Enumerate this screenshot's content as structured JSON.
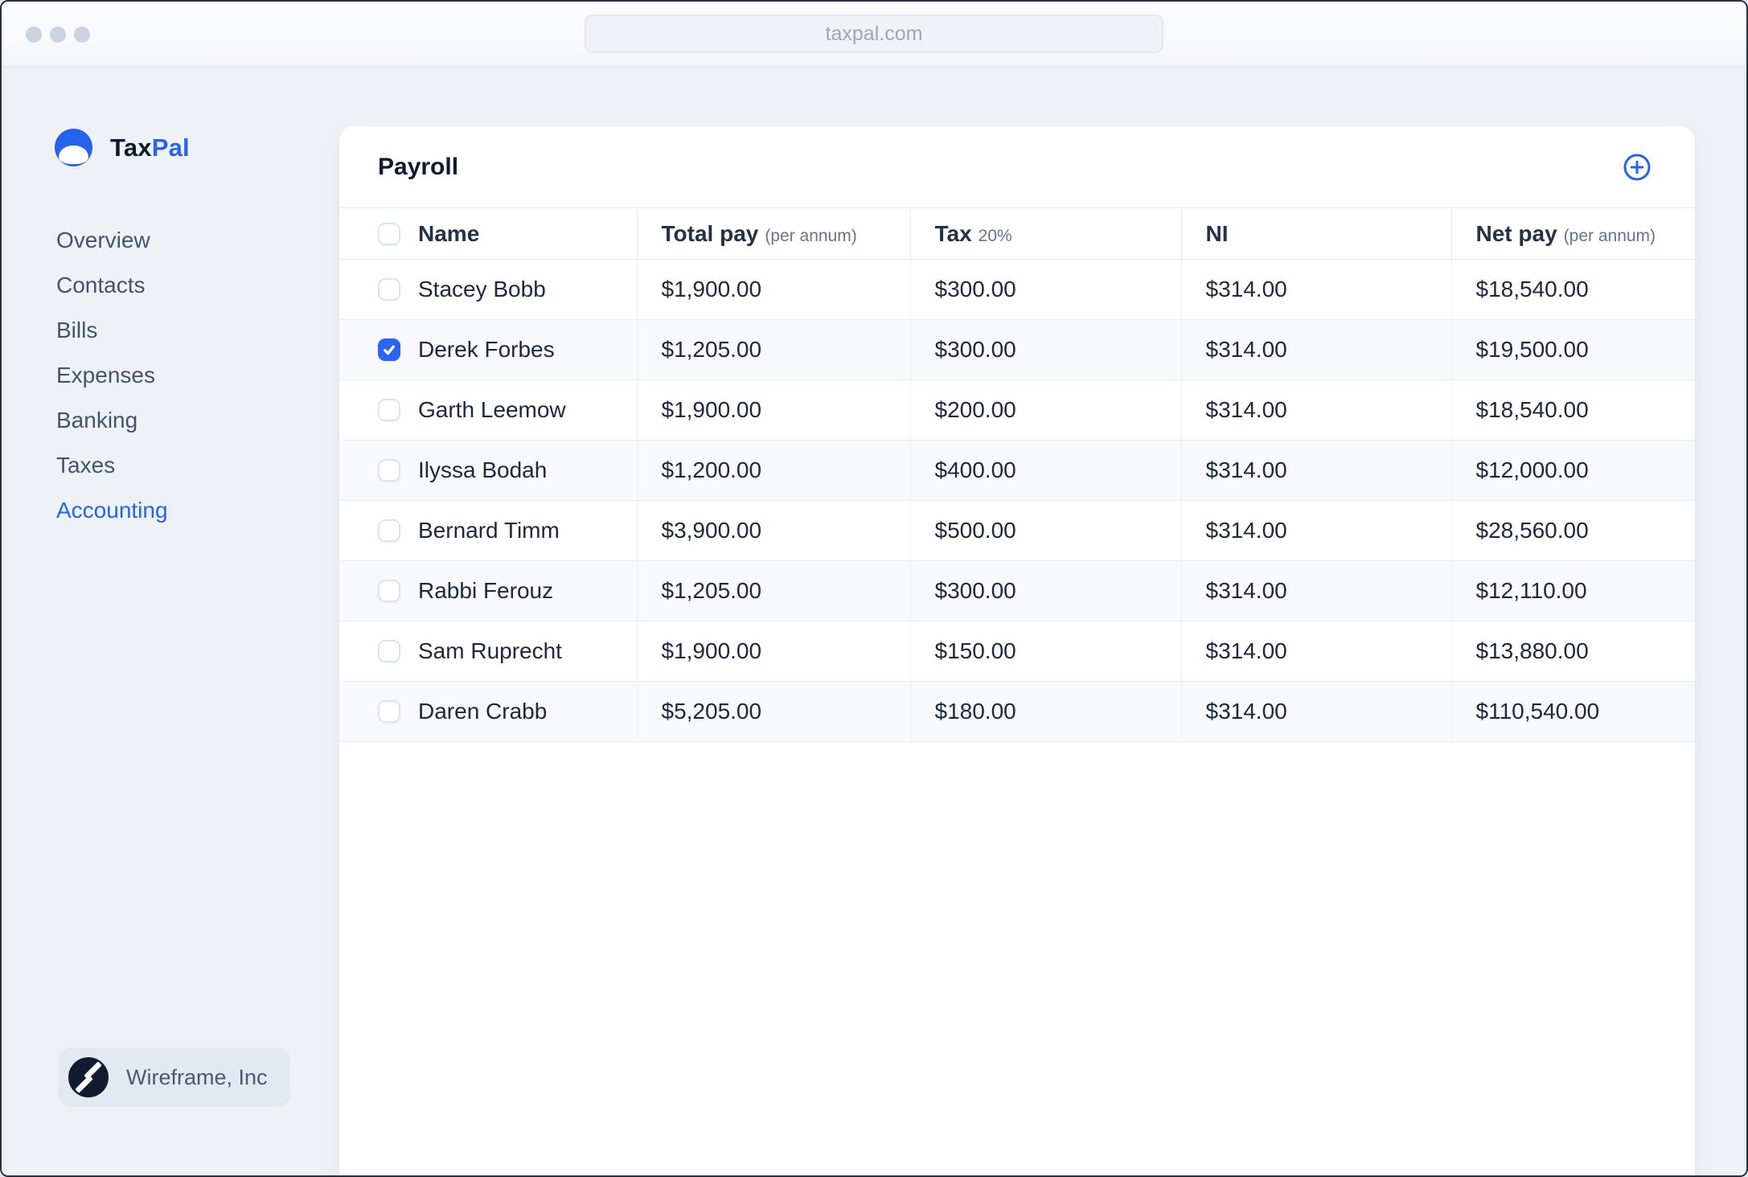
{
  "browser": {
    "url": "taxpal.com"
  },
  "brand": {
    "name_primary": "Tax",
    "name_secondary": "Pal"
  },
  "colors": {
    "accent": "#2563eb",
    "active_nav": "#2563eb",
    "checked_checkbox": "#2b64f0",
    "zebra_row": "#f7f9fc"
  },
  "icons": {
    "logo": "smile-circle-icon",
    "add": "circle-plus-icon",
    "check": "checkmark-icon",
    "org": "double-slash-icon"
  },
  "sidebar": {
    "items": [
      {
        "label": "Overview",
        "active": false
      },
      {
        "label": "Contacts",
        "active": false
      },
      {
        "label": "Bills",
        "active": false
      },
      {
        "label": "Expenses",
        "active": false
      },
      {
        "label": "Banking",
        "active": false
      },
      {
        "label": "Taxes",
        "active": false
      },
      {
        "label": "Accounting",
        "active": true
      }
    ],
    "org": {
      "name": "Wireframe, Inc"
    }
  },
  "payroll": {
    "title": "Payroll",
    "columns": [
      {
        "label": "Name",
        "sub": ""
      },
      {
        "label": "Total pay",
        "sub": "(per annum)"
      },
      {
        "label": "Tax",
        "sub": "20%"
      },
      {
        "label": "NI",
        "sub": ""
      },
      {
        "label": "Net pay",
        "sub": "(per annum)"
      }
    ],
    "rows": [
      {
        "name": "Stacey Bobb",
        "checked": false,
        "total_pay": "$1,900.00",
        "tax": "$300.00",
        "ni": "$314.00",
        "net_pay": "$18,540.00"
      },
      {
        "name": "Derek Forbes",
        "checked": true,
        "total_pay": "$1,205.00",
        "tax": "$300.00",
        "ni": "$314.00",
        "net_pay": "$19,500.00"
      },
      {
        "name": "Garth Leemow",
        "checked": false,
        "total_pay": "$1,900.00",
        "tax": "$200.00",
        "ni": "$314.00",
        "net_pay": "$18,540.00"
      },
      {
        "name": "Ilyssa Bodah",
        "checked": false,
        "total_pay": "$1,200.00",
        "tax": "$400.00",
        "ni": "$314.00",
        "net_pay": "$12,000.00"
      },
      {
        "name": "Bernard Timm",
        "checked": false,
        "total_pay": "$3,900.00",
        "tax": "$500.00",
        "ni": "$314.00",
        "net_pay": "$28,560.00"
      },
      {
        "name": "Rabbi Ferouz",
        "checked": false,
        "total_pay": "$1,205.00",
        "tax": "$300.00",
        "ni": "$314.00",
        "net_pay": "$12,110.00"
      },
      {
        "name": "Sam Ruprecht",
        "checked": false,
        "total_pay": "$1,900.00",
        "tax": "$150.00",
        "ni": "$314.00",
        "net_pay": "$13,880.00"
      },
      {
        "name": "Daren Crabb",
        "checked": false,
        "total_pay": "$5,205.00",
        "tax": "$180.00",
        "ni": "$314.00",
        "net_pay": "$110,540.00"
      }
    ]
  }
}
